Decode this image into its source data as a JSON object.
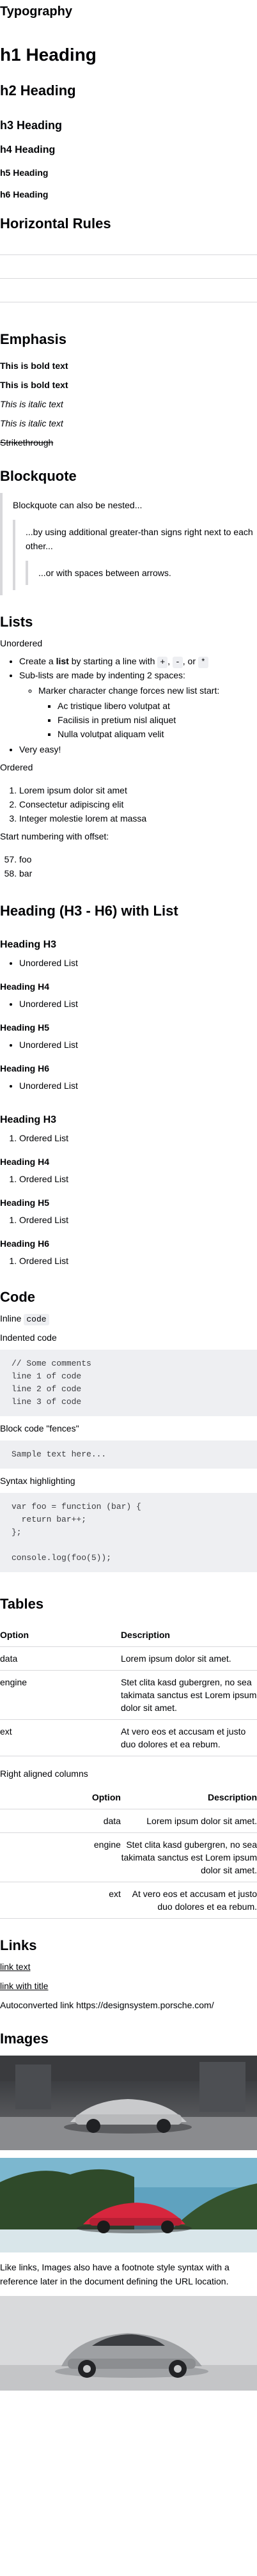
{
  "typography": {
    "title": "Typography",
    "h1": "h1 Heading",
    "h2": "h2 Heading",
    "h3": "h3 Heading",
    "h4": "h4 Heading",
    "h5": "h5 Heading",
    "h6": "h6 Heading"
  },
  "horizontal_rules": {
    "title": "Horizontal Rules"
  },
  "emphasis": {
    "title": "Emphasis",
    "bold_1": "This is bold text",
    "bold_2": "This is bold text",
    "italic_1": "This is italic text",
    "italic_2": "This is italic text",
    "strike": "Strikethrough"
  },
  "blockquote": {
    "title": "Blockquote",
    "level1": "Blockquote can also be nested...",
    "level2": "...by using additional greater-than signs right next to each other...",
    "level3": "...or with spaces between arrows."
  },
  "lists": {
    "title": "Lists",
    "unordered_label": "Unordered",
    "ul_item_1_pre": "Create a ",
    "ul_item_1_bold": "list",
    "ul_item_1_mid": " by starting a line with ",
    "ul_item_1_k1": "+",
    "ul_item_1_sep1": ", ",
    "ul_item_1_k2": "-",
    "ul_item_1_sep2": ", or ",
    "ul_item_1_k3": "*",
    "ul_item_2": "Sub-lists are made by indenting 2 spaces:",
    "ul_item_2a": "Marker character change forces new list start:",
    "ul_item_2a_i": "Ac tristique libero volutpat at",
    "ul_item_2a_ii": "Facilisis in pretium nisl aliquet",
    "ul_item_2a_iii": "Nulla volutpat aliquam velit",
    "ul_item_3": "Very easy!",
    "ordered_label": "Ordered",
    "ol_1": "Lorem ipsum dolor sit amet",
    "ol_2": "Consectetur adipiscing elit",
    "ol_3": "Integer molestie lorem at massa",
    "offset_label": "Start numbering with offset:",
    "offset_1": "foo",
    "offset_2": "bar"
  },
  "headings_with_list": {
    "title": "Heading (H3 - H6) with List",
    "h3": "Heading H3",
    "h4": "Heading H4",
    "h5": "Heading H5",
    "h6": "Heading H6",
    "unordered_item": "Unordered List",
    "ordered_item": "Ordered List"
  },
  "code": {
    "title": "Code",
    "inline_label": "Inline",
    "inline_code": "code",
    "indented_label": "Indented code",
    "indented_block": "// Some comments\nline 1 of code\nline 2 of code\nline 3 of code",
    "fences_label": "Block code \"fences\"",
    "fences_block": "Sample text here...",
    "highlight_label": "Syntax highlighting",
    "highlight_block": "var foo = function (bar) {\n  return bar++;\n};\n\nconsole.log(foo(5));"
  },
  "tables": {
    "title": "Tables",
    "col_option": "Option",
    "col_description": "Description",
    "rows": [
      {
        "option": "data",
        "description": "Lorem ipsum dolor sit amet."
      },
      {
        "option": "engine",
        "description": "Stet clita kasd gubergren, no sea takimata sanctus est Lorem ipsum dolor sit amet."
      },
      {
        "option": "ext",
        "description": "At vero eos et accusam et justo duo dolores et ea rebum."
      }
    ],
    "right_label": "Right aligned columns"
  },
  "links": {
    "title": "Links",
    "link_text": "link text",
    "link_title": "link with title",
    "autoconverted": "Autoconverted link https://designsystem.porsche.com/"
  },
  "images": {
    "title": "Images",
    "caption": "Like links, Images also have a footnote style syntax with a reference later in the document defining the URL location."
  }
}
